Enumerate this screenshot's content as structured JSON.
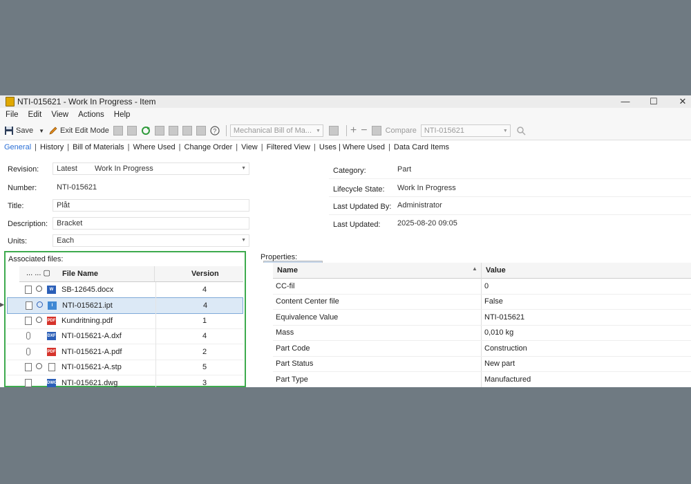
{
  "window": {
    "title": "NTI-015621 - Work In Progress - Item",
    "min": "—",
    "max": "☐",
    "close": "✕"
  },
  "menu": [
    "File",
    "Edit",
    "View",
    "Actions",
    "Help"
  ],
  "toolbar": {
    "save_label": "Save",
    "exit_edit_label": "Exit Edit Mode",
    "bom_combo": "Mechanical Bill of Ma...",
    "compare_label": "Compare",
    "compare_target": "NTI-015621"
  },
  "tabs": [
    "General",
    "History",
    "Bill of Materials",
    "Where Used",
    "Change Order",
    "View",
    "Filtered View",
    "Uses | Where Used",
    "Data Card Items"
  ],
  "fields": {
    "revision_label": "Revision:",
    "revision_value": "Latest",
    "revision_state": "Work In Progress",
    "number_label": "Number:",
    "number_value": "NTI-015621",
    "title_label": "Title:",
    "title_value": "Plåt",
    "description_label": "Description:",
    "description_value": "Bracket",
    "units_label": "Units:",
    "units_value": "Each"
  },
  "summary": {
    "category_label": "Category:",
    "category_value": "Part",
    "lifecycle_label": "Lifecycle State:",
    "lifecycle_value": "Work In Progress",
    "updated_by_label": "Last Updated By:",
    "updated_by_value": "Administrator",
    "updated_label": "Last Updated:",
    "updated_value": "2025-08-20 09:05"
  },
  "associated": {
    "title": "Associated files:",
    "col_name": "File Name",
    "col_version": "Version",
    "rows": [
      {
        "name": "SB-12645.docx",
        "version": "4",
        "type": "docx"
      },
      {
        "name": "NTI-015621.ipt",
        "version": "4",
        "type": "ipt"
      },
      {
        "name": "Kundritning.pdf",
        "version": "1",
        "type": "pdf"
      },
      {
        "name": "NTI-015621-A.dxf",
        "version": "4",
        "type": "dxf"
      },
      {
        "name": "NTI-015621-A.pdf",
        "version": "2",
        "type": "pdf"
      },
      {
        "name": "NTI-015621-A.stp",
        "version": "5",
        "type": "stp"
      },
      {
        "name": "NTI-015621.dwg",
        "version": "3",
        "type": "dwg"
      }
    ]
  },
  "properties": {
    "title": "Properties:",
    "col_name": "Name",
    "col_value": "Value",
    "rows": [
      {
        "name": "CC-fil",
        "value": "0"
      },
      {
        "name": "Content Center file",
        "value": "False"
      },
      {
        "name": "Equivalence Value",
        "value": "NTI-015621"
      },
      {
        "name": "Mass",
        "value": "0,010 kg"
      },
      {
        "name": "Part Code",
        "value": "Construction"
      },
      {
        "name": "Part Status",
        "value": "New part"
      },
      {
        "name": "Part Type",
        "value": "Manufactured"
      }
    ]
  },
  "colors": {
    "accent": "#2a6fd6",
    "highlight_border": "#3daa4d",
    "selection": "#dce9f6"
  }
}
